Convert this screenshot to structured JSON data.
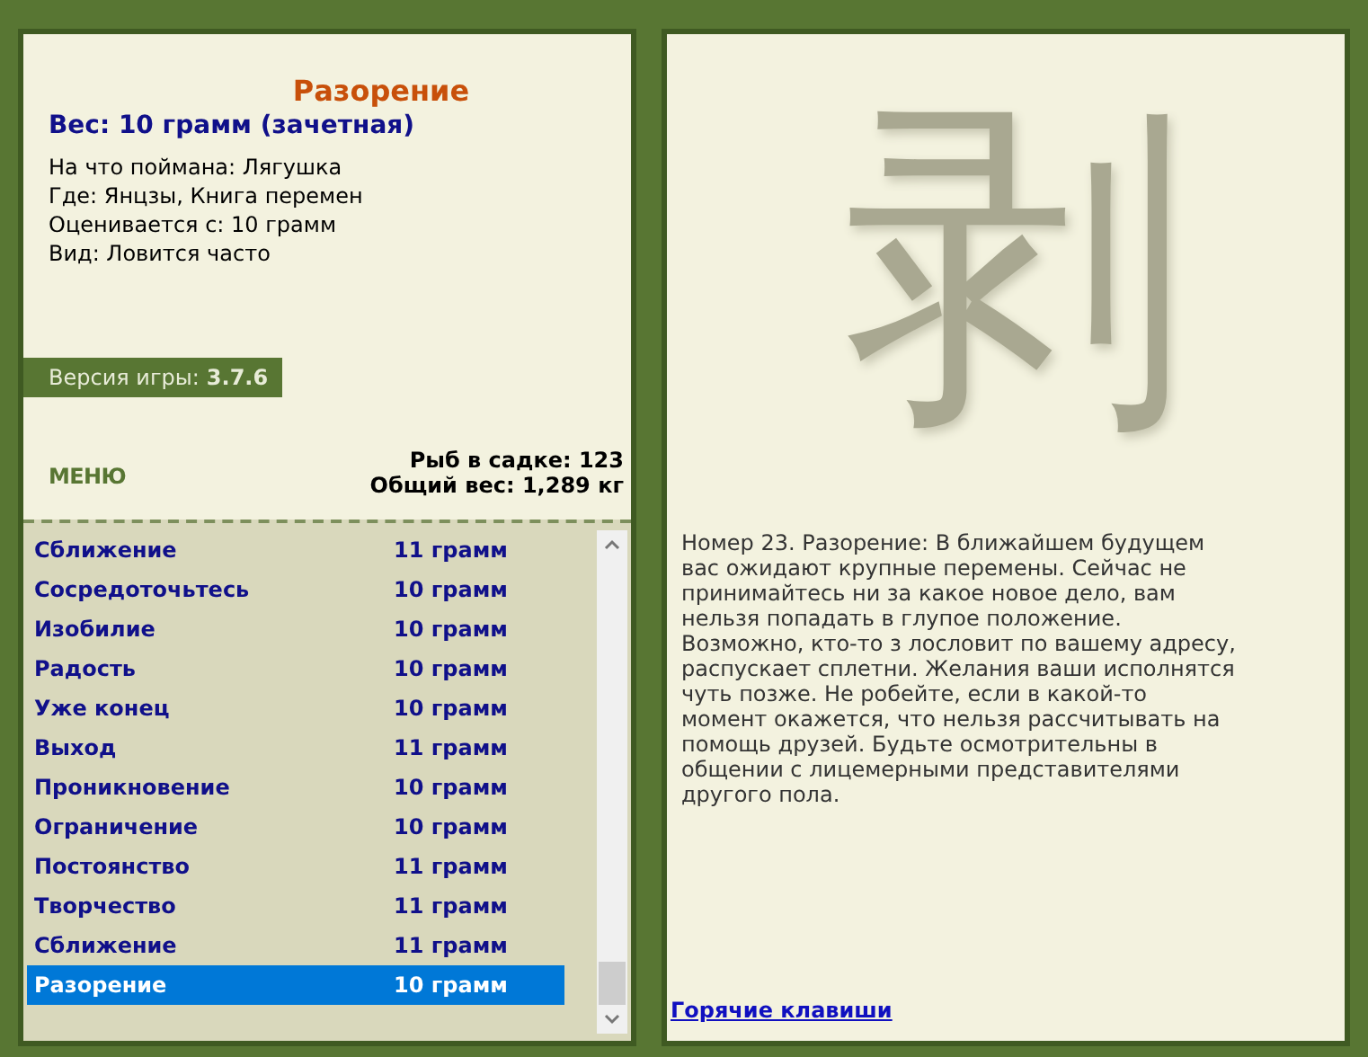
{
  "fish": {
    "title": "Разорение",
    "weight": "Вес: 10 грамм (зачетная)",
    "details": [
      "На что поймана: Лягушка",
      "Где: Янцзы, Книга перемен",
      "Оценивается с: 10 грамм",
      "Вид: Ловится часто"
    ]
  },
  "version": {
    "label": "Версия игры:",
    "value": "3.7.6"
  },
  "menu": "МЕНЮ",
  "stats": [
    "Рыб в садке: 123",
    "Общий вес: 1,289 кг"
  ],
  "catch_list": [
    {
      "name": "Сближение",
      "weight": "11 грамм",
      "selected": false
    },
    {
      "name": "Сосредоточьтесь",
      "weight": "10 грамм",
      "selected": false
    },
    {
      "name": "Изобилие",
      "weight": "10 грамм",
      "selected": false
    },
    {
      "name": "Радость",
      "weight": "10 грамм",
      "selected": false
    },
    {
      "name": "Уже конец",
      "weight": "10 грамм",
      "selected": false
    },
    {
      "name": "Выход",
      "weight": "11 грамм",
      "selected": false
    },
    {
      "name": "Проникновение",
      "weight": "10 грамм",
      "selected": false
    },
    {
      "name": "Ограничение",
      "weight": "10 грамм",
      "selected": false
    },
    {
      "name": "Постоянство",
      "weight": "11 грамм",
      "selected": false
    },
    {
      "name": "Творчество",
      "weight": "11 грамм",
      "selected": false
    },
    {
      "name": "Сближение",
      "weight": "11 грамм",
      "selected": false
    },
    {
      "name": "Разорение",
      "weight": "10 грамм",
      "selected": true
    }
  ],
  "hexagram_glyph": "剥",
  "description": "Номер 23. Разорение: В ближайшем будущем вас ожидают крупные перемены. Сейчас не принимайтесь ни за какое новое дело, вам нельзя попадать в глупое положение. Возможно, кто-то з лословит по вашему адресу, распускает сплетни. Желания ваши исполнятся чуть позже. Не робейте, если в какой-то момент окажется, что нельзя рассчитывать на помощь друзей. Будьте осмотрительны в общении с лицемерными представителями другого пола.",
  "hotkeys_link": "Горячие клавиши"
}
